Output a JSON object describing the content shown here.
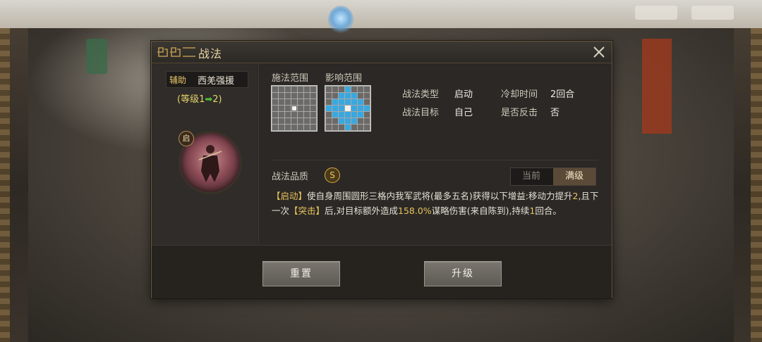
{
  "dialog": {
    "title": "战法",
    "close_icon": "close-icon"
  },
  "hero": {
    "role_tag": "辅助",
    "skill_name": "西羌强援",
    "level_prefix": "(等级1",
    "level_arrow": "➡",
    "level_suffix": "2)",
    "portrait_badge": "启"
  },
  "range": {
    "cast_label": "施法范围",
    "effect_label": "影响范围"
  },
  "info": {
    "type_key": "战法类型",
    "type_val": "启动",
    "target_key": "战法目标",
    "target_val": "自己",
    "cooldown_key": "冷却时间",
    "cooldown_val": "2回合",
    "counter_key": "是否反击",
    "counter_val": "否"
  },
  "quality": {
    "label": "战法品质",
    "grade": "S"
  },
  "toggle": {
    "current": "当前",
    "max": "满级",
    "selected": "满级"
  },
  "description": {
    "kw1": "【启动】",
    "t1": "使自身周围圆形三格内我军武将(最多五名)获得以下增益:移动力提升",
    "n1": "2",
    "t2": ",且下一次",
    "kw2": "【突击】",
    "t3": "后,对目标额外造成",
    "n2": "158.0%",
    "t4": "谋略伤害(来自陈到),持续",
    "n3": "1",
    "t5": "回合。"
  },
  "buttons": {
    "reset": "重置",
    "upgrade": "升级"
  },
  "colors": {
    "accent_gold": "#e8c45a",
    "range_blue": "#3aa8e0",
    "arrow_green": "#4fc23a"
  }
}
